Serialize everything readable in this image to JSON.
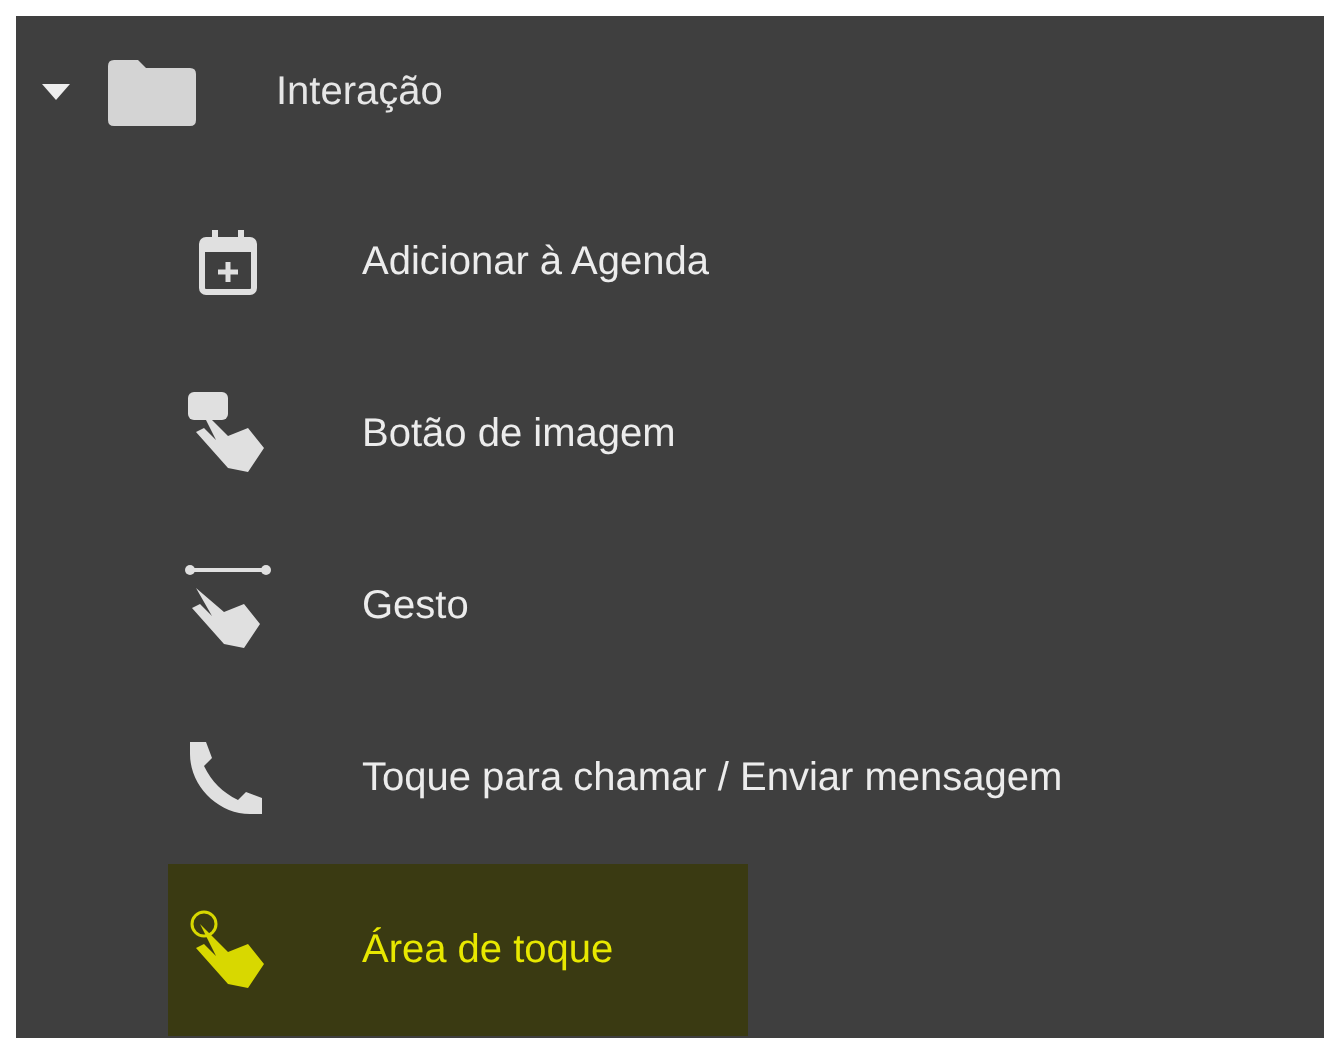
{
  "tree": {
    "label": "Interação",
    "expanded": true,
    "children": [
      {
        "label": "Adicionar à Agenda",
        "kind": "calendar",
        "selected": false
      },
      {
        "label": "Botão de imagem",
        "kind": "image-button",
        "selected": false
      },
      {
        "label": "Gesto",
        "kind": "gesture",
        "selected": false
      },
      {
        "label": "Toque para chamar / Enviar mensagem",
        "kind": "phone",
        "selected": false
      },
      {
        "label": "Área de toque",
        "kind": "touch-area",
        "selected": true
      }
    ]
  }
}
